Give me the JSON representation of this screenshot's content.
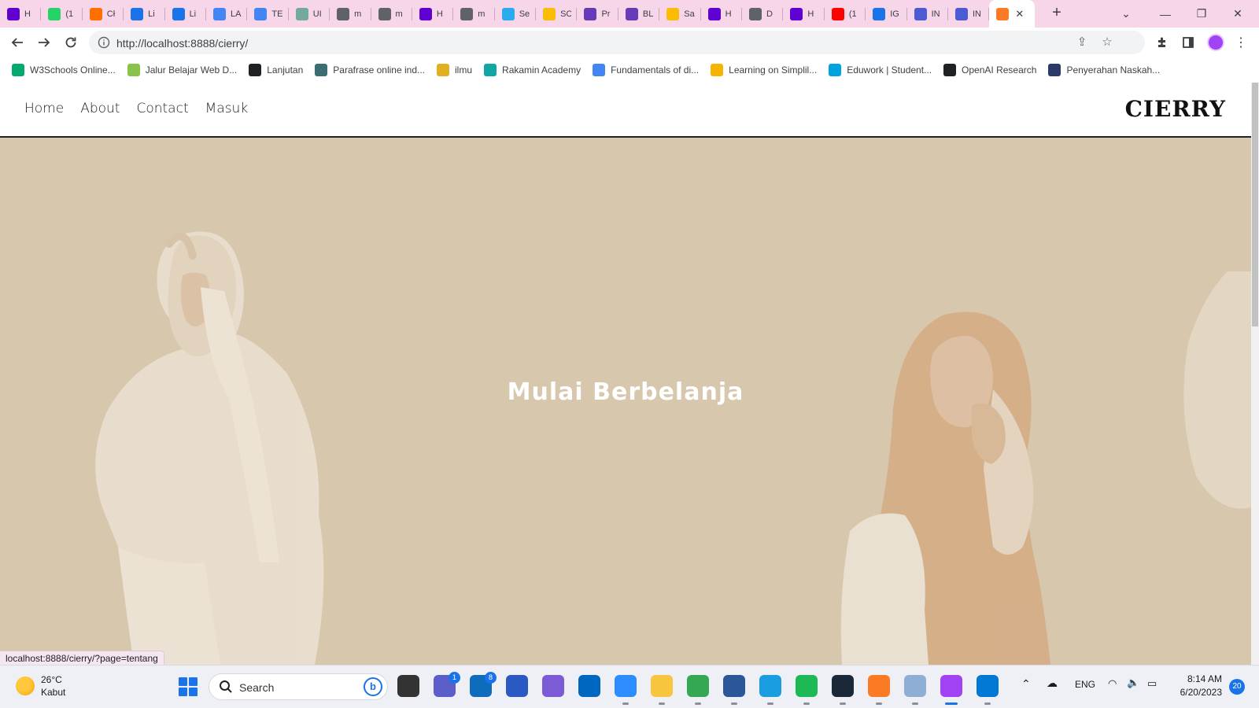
{
  "browser": {
    "tabs": [
      {
        "title": "H",
        "fav": "#5f01d1"
      },
      {
        "title": "(1",
        "fav": "#25d366"
      },
      {
        "title": "Cł",
        "fav": "#ff6f00"
      },
      {
        "title": "Li",
        "fav": "#1a73e8"
      },
      {
        "title": "Li",
        "fav": "#1a73e8"
      },
      {
        "title": "LA",
        "fav": "#4285f4"
      },
      {
        "title": "TE",
        "fav": "#4285f4"
      },
      {
        "title": "UI",
        "fav": "#74aa9c"
      },
      {
        "title": "m",
        "fav": "#5f6368"
      },
      {
        "title": "m",
        "fav": "#5f6368"
      },
      {
        "title": "H",
        "fav": "#5f01d1"
      },
      {
        "title": "m",
        "fav": "#5f6368"
      },
      {
        "title": "Se",
        "fav": "#2aabee"
      },
      {
        "title": "SC",
        "fav": "#fbbc04"
      },
      {
        "title": "Pr",
        "fav": "#673ab7"
      },
      {
        "title": "BL",
        "fav": "#673ab7"
      },
      {
        "title": "Sa",
        "fav": "#fbbc04"
      },
      {
        "title": "H",
        "fav": "#5f01d1"
      },
      {
        "title": "D",
        "fav": "#5f6368"
      },
      {
        "title": "H",
        "fav": "#5f01d1"
      },
      {
        "title": "(1",
        "fav": "#ff0000"
      },
      {
        "title": "IG",
        "fav": "#1a73e8"
      },
      {
        "title": "IN",
        "fav": "#4c5bd4"
      },
      {
        "title": "IN",
        "fav": "#4c5bd4"
      }
    ],
    "active_tab": {
      "title": "",
      "fav": "#fb7a24"
    },
    "new_tab_label": "+",
    "url": "http://localhost:8888/cierry/",
    "bookmarks": [
      {
        "label": "W3Schools Online...",
        "fav": "#04aa6d"
      },
      {
        "label": "Jalur Belajar Web D...",
        "fav": "#8bc34a"
      },
      {
        "label": "Lanjutan",
        "fav": "#202124"
      },
      {
        "label": "Parafrase online ind...",
        "fav": "#3c6e71"
      },
      {
        "label": "ilmu",
        "fav": "#e0b020"
      },
      {
        "label": "Rakamin Academy",
        "fav": "#10a6a6"
      },
      {
        "label": "Fundamentals of di...",
        "fav": "#4285f4"
      },
      {
        "label": "Learning on Simplil...",
        "fav": "#f4b400"
      },
      {
        "label": "Eduwork | Student...",
        "fav": "#00a3e0"
      },
      {
        "label": "OpenAI Research",
        "fav": "#202124"
      },
      {
        "label": "Penyerahan Naskah...",
        "fav": "#2b3a67"
      }
    ],
    "status_url": "localhost:8888/cierry/?page=tentang"
  },
  "site": {
    "nav": [
      "Home",
      "About",
      "Contact",
      "Masuk"
    ],
    "brand": "CIERRY",
    "hero_title": "Mulai Berbelanja",
    "hero_bg": "#d6c7ad"
  },
  "taskbar": {
    "weather_temp": "26°C",
    "weather_desc": "Kabut",
    "search_placeholder": "Search",
    "apps": [
      {
        "name": "task-view",
        "color": "#333333",
        "badge": ""
      },
      {
        "name": "teams",
        "color": "#5b5fc7",
        "badge": "1"
      },
      {
        "name": "mail",
        "color": "#0f6cbd",
        "badge": "8"
      },
      {
        "name": "math",
        "color": "#2b59c3",
        "badge": ""
      },
      {
        "name": "copilot",
        "color": "#7c5cd6",
        "badge": ""
      },
      {
        "name": "store",
        "color": "#0067c0",
        "badge": ""
      },
      {
        "name": "zoom",
        "color": "#2d8cff",
        "badge": ""
      },
      {
        "name": "explorer",
        "color": "#f8c53f",
        "badge": ""
      },
      {
        "name": "chrome",
        "color": "#34a853",
        "badge": ""
      },
      {
        "name": "word",
        "color": "#2b579a",
        "badge": ""
      },
      {
        "name": "edge",
        "color": "#1b9de2",
        "badge": ""
      },
      {
        "name": "spotify",
        "color": "#1db954",
        "badge": ""
      },
      {
        "name": "steam",
        "color": "#1b2838",
        "badge": ""
      },
      {
        "name": "xampp",
        "color": "#fb7a24",
        "badge": ""
      },
      {
        "name": "monitor",
        "color": "#8faed6",
        "badge": ""
      },
      {
        "name": "chrome-profile",
        "color": "#a142f4",
        "badge": ""
      },
      {
        "name": "vscode",
        "color": "#0078d4",
        "badge": ""
      }
    ],
    "lang": "ENG",
    "time": "8:14 AM",
    "date": "6/20/2023",
    "notifications": "20"
  }
}
